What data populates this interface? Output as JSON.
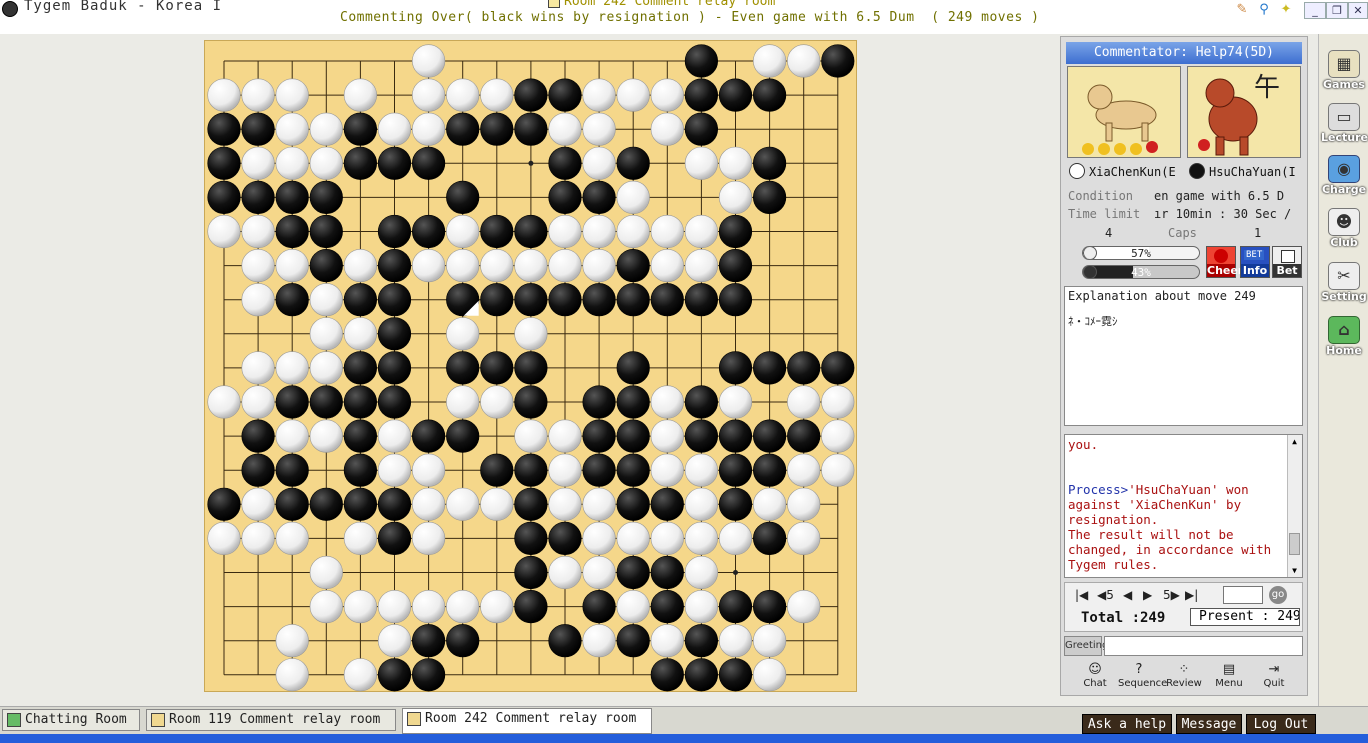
{
  "window": {
    "app_title": "Tygem Baduk - Korea I",
    "room_title": "Room 242 Comment relay room",
    "status": "Commenting Over( black wins by resignation ) - Even game with 6.5 Dum  ( 249 moves )"
  },
  "commentator": "Commentator: Help74(5D)",
  "players": {
    "white_name": "XiaChenKun(E",
    "black_name": "HsuChaYuan(I"
  },
  "portrait_right_char": "午",
  "game_info": {
    "condition_label": "Condition",
    "condition_value": "en game with 6.5 D",
    "time_label": "Time limit",
    "time_value": "ır 10min : 30 Sec /",
    "caps_label": "Caps",
    "caps_white": "4",
    "caps_black": "1"
  },
  "win_bars": {
    "white_pct_label": "57%",
    "white_fraction": 0.57,
    "black_pct_label": "43%",
    "black_fraction": 0.43
  },
  "action_buttons": [
    "Cheer",
    "Info",
    "Bet"
  ],
  "explanation": {
    "header": "Explanation about move 249",
    "body": "ﾈ・ｺﾒｰ霓ｼ"
  },
  "chat": {
    "line0": "you.",
    "process_prefix": "Process>",
    "line1": "'HsuChaYuan' won",
    "line2": "against 'XiaChenKun' by",
    "line3": "resignation.",
    "line4": "The result will not be",
    "line5": "changed, in accordance with",
    "line6": "Tygem rules."
  },
  "nav": {
    "first": "|◀",
    "back5": "◀5",
    "back1": "◀",
    "fwd1": "▶",
    "fwd5": "5▶",
    "last": "▶|",
    "go": "go",
    "total": "Total :249",
    "present": "Present : 249"
  },
  "greeting_label": "Greeting",
  "tools": [
    "Chat",
    "Sequence",
    "Review",
    "Menu",
    "Quit"
  ],
  "sidebar": [
    "Games",
    "Lecture",
    "Charge",
    "Club",
    "Setting",
    "Home"
  ],
  "tabs": [
    "Chatting Room",
    "Room 119 Comment relay room",
    "Room 242 Comment relay room"
  ],
  "bottom_buttons": [
    "Ask a help",
    "Message",
    "Log Out"
  ],
  "colors": {
    "board": "#f5d78a",
    "commentator_bar": "#3d6ed0",
    "process_text": "#2233aa",
    "result_text": "#aa1111"
  },
  "board": {
    "size": 19,
    "last_move": [
      7,
      7
    ],
    "rows": [
      "......W.......B.WWB",
      "WWW.W.WWWBBWWWBBB..",
      "BBWWBWWBBBWW.WB....",
      "BWWWBBB...BWB.WWB..",
      "BBBB...B..BBW..WB..",
      "WWBB.BBWBBWWWWWB...",
      ".WWBWBWWWWWWBWWB...",
      ".WBWBB.BBBBBBBBB...",
      "...WWB.W.W.........",
      ".WWWBB.BBB..B..BBBB",
      "WWBBBB.WWB.BBWBW.WW",
      ".BWWBWBB.WWBBWBBBBW",
      ".BB.BWW.BBWBBWWBBWW",
      "BWBBBBWWWBWWBBWBWW.",
      "WWW.WBW..BBWWWWWBW.",
      "...W.....BWWBBW....",
      "...WWWWWWB.BWBWBBW.",
      "..W..WBB..BWBWBWW..",
      "..W.WBB......BBBW.."
    ]
  }
}
